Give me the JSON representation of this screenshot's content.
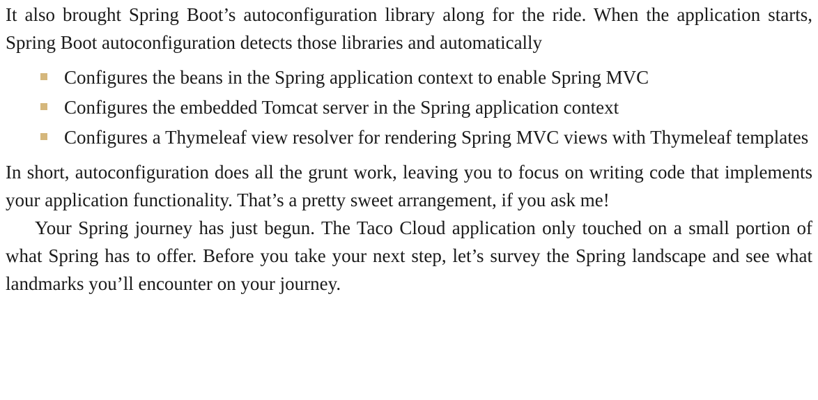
{
  "paragraphs": {
    "intro": "It also brought Spring Boot’s autoconfiguration library along for the ride. When the application starts, Spring Boot autoconfiguration detects those libraries and automatically",
    "summary": "In short, autoconfiguration does all the grunt work, leaving you to focus on writing code that implements your application functionality. That’s a pretty sweet arrange­ment, if you ask me!",
    "journey": "Your Spring journey has just begun. The Taco Cloud application only touched on a small portion of what Spring has to offer. Before you take your next step, let’s survey the Spring landscape and see what landmarks you’ll encounter on your journey."
  },
  "bullets": [
    "Configures the beans in the Spring application context to enable Spring MVC",
    "Configures the embedded Tomcat server in the Spring application context",
    "Configures a Thymeleaf view resolver for rendering Spring MVC views with Thymeleaf templates"
  ],
  "colors": {
    "bullet": "#d5b77c",
    "text": "#1a1a1a"
  }
}
